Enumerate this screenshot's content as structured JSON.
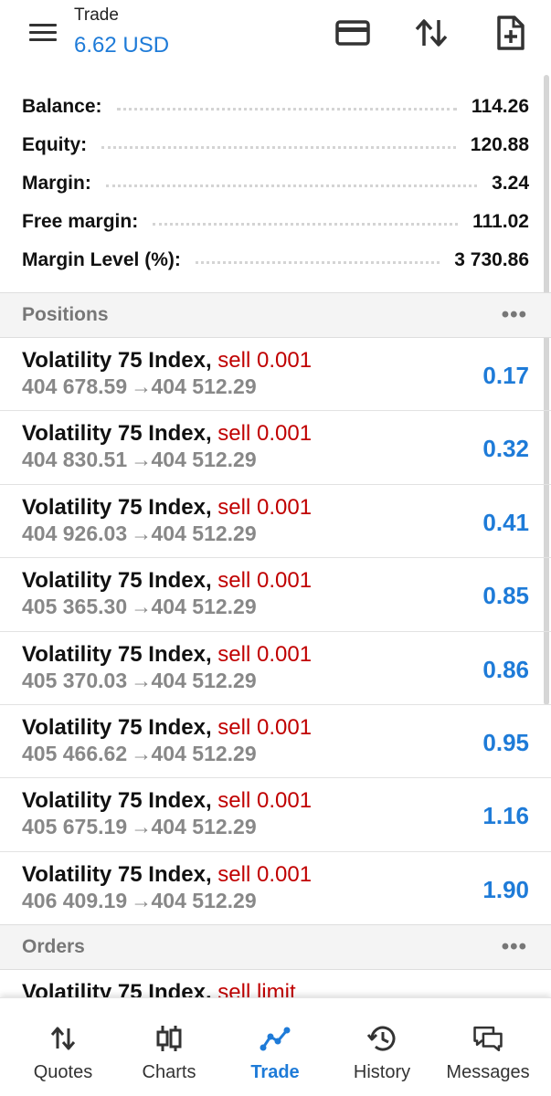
{
  "header": {
    "title": "Trade",
    "balance": "6.62 USD",
    "icons": [
      "menu-icon",
      "credit-card-icon",
      "sort-arrows-icon",
      "new-order-icon"
    ]
  },
  "summary": [
    {
      "label": "Balance:",
      "value": "114.26"
    },
    {
      "label": "Equity:",
      "value": "120.88"
    },
    {
      "label": "Margin:",
      "value": "3.24"
    },
    {
      "label": "Free margin:",
      "value": "111.02"
    },
    {
      "label": "Margin Level (%):",
      "value": "3 730.86"
    }
  ],
  "positions_section": {
    "title": "Positions",
    "more": "•••"
  },
  "positions": [
    {
      "symbol": "Volatility 75 Index,",
      "side": "sell 0.001",
      "open": "404 678.59",
      "arrow": "→",
      "current": "404 512.29",
      "profit": "0.17"
    },
    {
      "symbol": "Volatility 75 Index,",
      "side": "sell 0.001",
      "open": "404 830.51",
      "arrow": "→",
      "current": "404 512.29",
      "profit": "0.32"
    },
    {
      "symbol": "Volatility 75 Index,",
      "side": "sell 0.001",
      "open": "404 926.03",
      "arrow": "→",
      "current": "404 512.29",
      "profit": "0.41"
    },
    {
      "symbol": "Volatility 75 Index,",
      "side": "sell 0.001",
      "open": "405 365.30",
      "arrow": "→",
      "current": "404 512.29",
      "profit": "0.85"
    },
    {
      "symbol": "Volatility 75 Index,",
      "side": "sell 0.001",
      "open": "405 370.03",
      "arrow": "→",
      "current": "404 512.29",
      "profit": "0.86"
    },
    {
      "symbol": "Volatility 75 Index,",
      "side": "sell 0.001",
      "open": "405 466.62",
      "arrow": "→",
      "current": "404 512.29",
      "profit": "0.95"
    },
    {
      "symbol": "Volatility 75 Index,",
      "side": "sell 0.001",
      "open": "405 675.19",
      "arrow": "→",
      "current": "404 512.29",
      "profit": "1.16"
    },
    {
      "symbol": "Volatility 75 Index,",
      "side": "sell 0.001",
      "open": "406 409.19",
      "arrow": "→",
      "current": "404 512.29",
      "profit": "1.90"
    }
  ],
  "orders_section": {
    "title": "Orders",
    "more": "•••"
  },
  "orders": [
    {
      "symbol": "Volatility 75 Index,",
      "side": "sell limit"
    }
  ],
  "nav": {
    "quotes": "Quotes",
    "charts": "Charts",
    "trade": "Trade",
    "history": "History",
    "messages": "Messages",
    "active": "Trade"
  },
  "colors": {
    "accent": "#1e7bd8",
    "sell": "#c00000",
    "muted": "#888888"
  }
}
